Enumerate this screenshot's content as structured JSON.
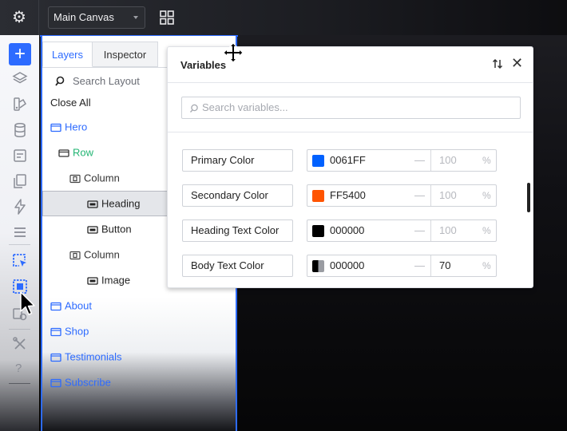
{
  "topbar": {
    "canvas_selector": "Main Canvas"
  },
  "layers_panel": {
    "tabs": [
      {
        "label": "Layers",
        "active": true
      },
      {
        "label": "Inspector",
        "active": false
      }
    ],
    "search_placeholder": "Search Layout",
    "close_all": "Close All",
    "tree": [
      {
        "label": "Hero",
        "depth": 0,
        "color": "#2d6bff"
      },
      {
        "label": "Row",
        "depth": 1,
        "color": "#22b573"
      },
      {
        "label": "Column",
        "depth": 2,
        "color": "#333333"
      },
      {
        "label": "Heading",
        "depth": 3,
        "color": "#222222",
        "selected": true
      },
      {
        "label": "Button",
        "depth": 3,
        "color": "#222222"
      },
      {
        "label": "Column",
        "depth": 2,
        "color": "#333333"
      },
      {
        "label": "Image",
        "depth": 3,
        "color": "#222222"
      },
      {
        "label": "About",
        "depth": 0,
        "color": "#2d6bff"
      },
      {
        "label": "Shop",
        "depth": 0,
        "color": "#2d6bff"
      },
      {
        "label": "Testimonials",
        "depth": 0,
        "color": "#2d6bff"
      },
      {
        "label": "Subscribe",
        "depth": 0,
        "color": "#2d6bff"
      }
    ]
  },
  "variables_dialog": {
    "title": "Variables",
    "search_placeholder": "Search variables...",
    "rows": [
      {
        "name": "Primary Color",
        "hex": "0061FF",
        "swatch": "#0061FF",
        "opacity": "100",
        "opacity_set": false,
        "unit": "%"
      },
      {
        "name": "Secondary Color",
        "hex": "FF5400",
        "swatch": "#FF5400",
        "opacity": "100",
        "opacity_set": false,
        "unit": "%"
      },
      {
        "name": "Heading Text Color",
        "hex": "000000",
        "swatch": "#000000",
        "opacity": "100",
        "opacity_set": false,
        "unit": "%"
      },
      {
        "name": "Body Text Color",
        "hex": "000000",
        "swatch": "#000000",
        "opacity": "70",
        "opacity_set": true,
        "unit": "%"
      }
    ]
  },
  "colors": {
    "accent": "#2d6bff",
    "row_green": "#22b573"
  }
}
